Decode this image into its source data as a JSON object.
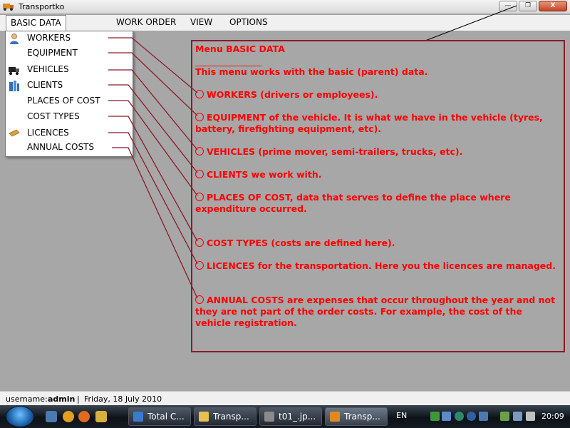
{
  "window": {
    "title": "Transportko",
    "minimize": "—",
    "maximize": "❐",
    "close": "X"
  },
  "menubar": {
    "items": [
      "BASIC DATA",
      "WORK ORDER",
      "VIEW",
      "OPTIONS"
    ]
  },
  "dropdown": {
    "items": [
      "WORKERS",
      "EQUIPMENT",
      "VEHICLES",
      "CLIENTS",
      "PLACES OF COST",
      "COST TYPES",
      "LICENCES",
      "ANNUAL COSTS"
    ]
  },
  "help": {
    "title": "Menu BASIC DATA",
    "separator": "_______________",
    "intro": "This menu works with the basic (parent) data.",
    "entries": [
      "WORKERS (drivers or employees).",
      "EQUIPMENT of the vehicle. It is what we have in the vehicle (tyres, battery, firefighting equipment, etc).",
      "VEHICLES (prime mover, semi-trailers, trucks, etc).",
      "CLIENTS we work with.",
      "PLACES OF COST, data that serves to define the place where expenditure occurred.",
      "COST TYPES (costs are defined here).",
      "LICENCES for the transportation. Here you the licences are managed.",
      "ANNUAL COSTS are expenses that occur throughout the year and not they are not part of the order costs. For example, the cost of the vehicle registration."
    ]
  },
  "status": {
    "username_label": "username:",
    "username": "admin",
    "sep": "|",
    "date": "Friday, 18 July 2010"
  },
  "taskbar": {
    "tasks": [
      "Total C...",
      "Transp...",
      "t01_.jp...",
      "Transp..."
    ],
    "language": "EN",
    "clock": "20:09"
  },
  "colors": {
    "accent": "#ff0000",
    "frame": "#8b1a2b",
    "background": "#a7a7a7"
  }
}
